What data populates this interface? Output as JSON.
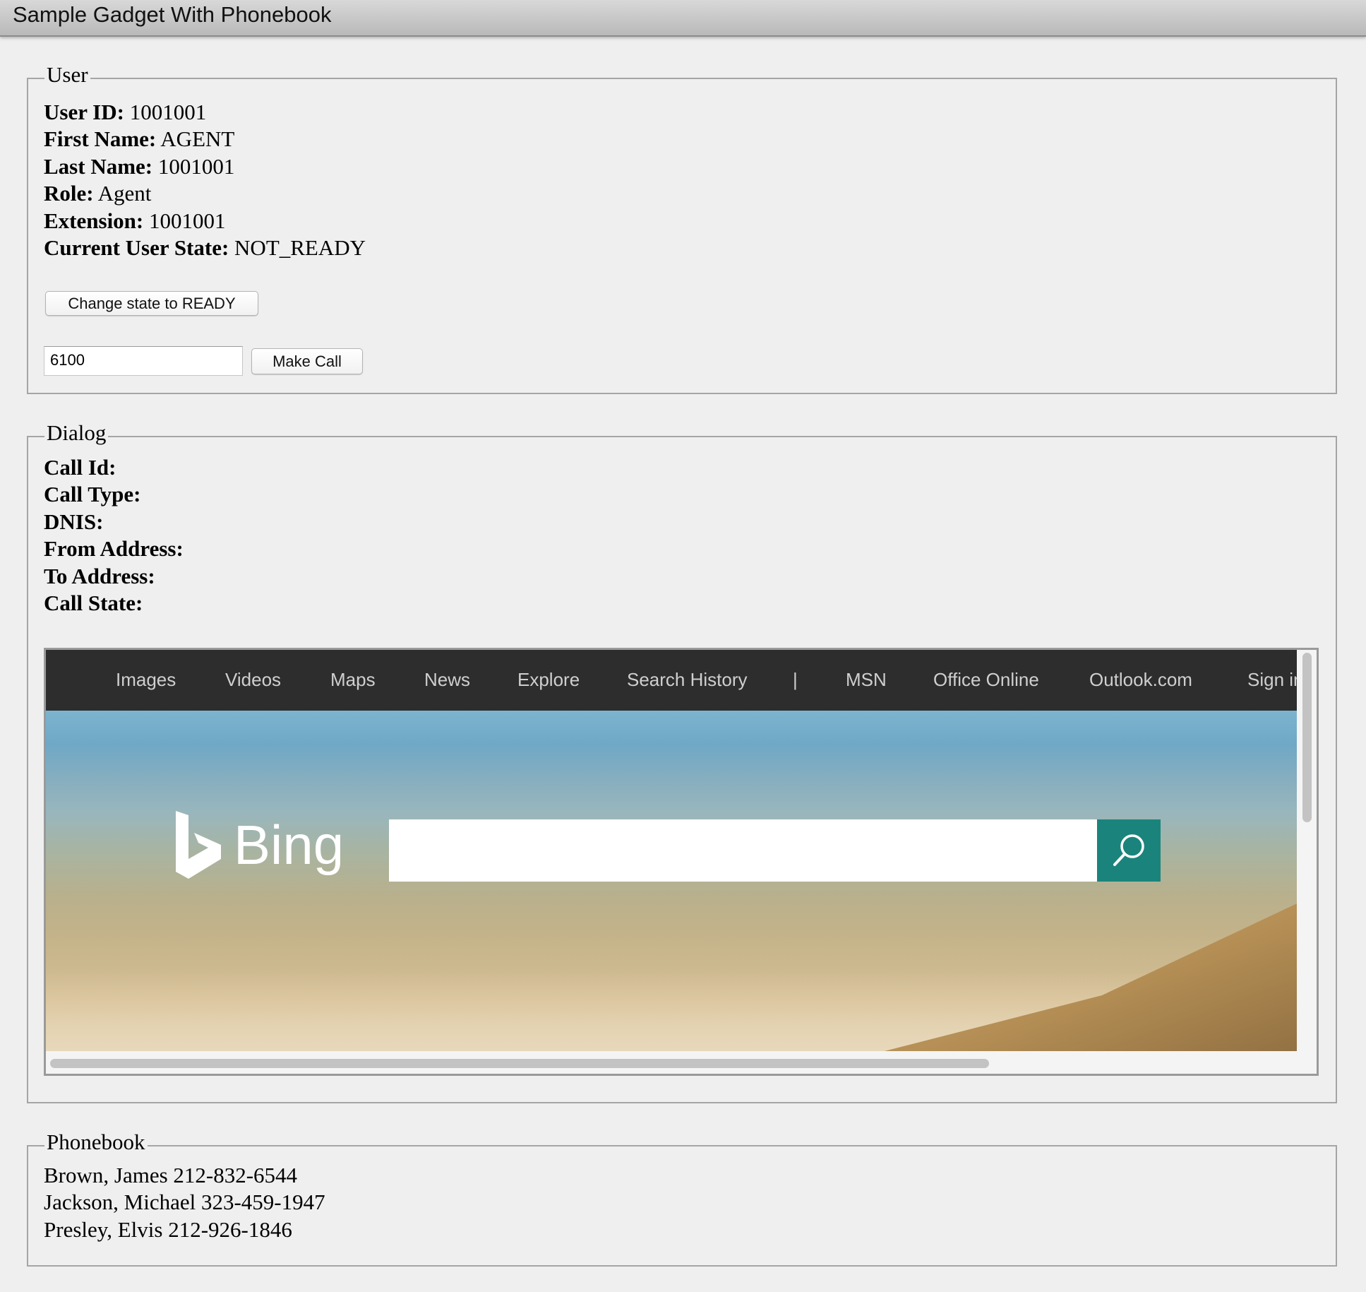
{
  "window": {
    "title": "Sample Gadget With Phonebook"
  },
  "user": {
    "legend": "User",
    "fields": [
      {
        "label": "User ID:",
        "value": "1001001"
      },
      {
        "label": "First Name:",
        "value": "AGENT"
      },
      {
        "label": "Last Name:",
        "value": "1001001"
      },
      {
        "label": "Role:",
        "value": "Agent"
      },
      {
        "label": "Extension:",
        "value": "1001001"
      },
      {
        "label": "Current User State:",
        "value": "NOT_READY"
      }
    ],
    "change_state_label": "Change state to READY",
    "dial_value": "6100",
    "make_call_label": "Make Call"
  },
  "dialog": {
    "legend": "Dialog",
    "fields": [
      {
        "label": "Call Id:",
        "value": ""
      },
      {
        "label": "Call Type:",
        "value": ""
      },
      {
        "label": "DNIS:",
        "value": ""
      },
      {
        "label": "From Address:",
        "value": ""
      },
      {
        "label": "To Address:",
        "value": ""
      },
      {
        "label": "Call State:",
        "value": ""
      }
    ]
  },
  "embedded": {
    "nav": [
      "Images",
      "Videos",
      "Maps",
      "News",
      "Explore",
      "Search History",
      "|",
      "MSN",
      "Office Online",
      "Outlook.com",
      "Sign in"
    ],
    "logo_text": "Bing",
    "search_value": "",
    "search_icon": "search-icon",
    "accent": "#1a847c"
  },
  "phonebook": {
    "legend": "Phonebook",
    "entries": [
      "Brown, James 212-832-6544",
      "Jackson, Michael 323-459-1947",
      "Presley, Elvis 212-926-1846"
    ]
  }
}
